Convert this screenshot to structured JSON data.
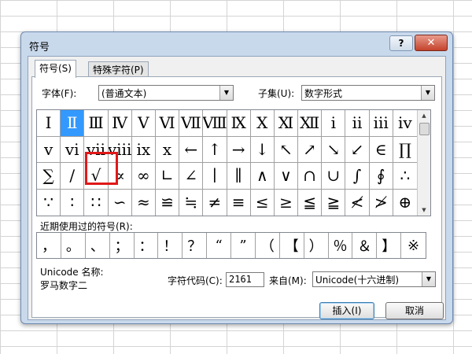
{
  "dialog": {
    "title": "符号",
    "help_label": "?",
    "close_label": "✕",
    "tabs": [
      {
        "label": "符号(S)"
      },
      {
        "label": "特殊字符(P)"
      }
    ],
    "font_label": "字体(F):",
    "font_value": "(普通文本)",
    "subset_label": "子集(U):",
    "subset_value": "数字形式",
    "symbol_rows": [
      [
        "Ⅰ",
        "Ⅱ",
        "Ⅲ",
        "Ⅳ",
        "Ⅴ",
        "Ⅵ",
        "Ⅶ",
        "Ⅷ",
        "Ⅸ",
        "Ⅹ",
        "Ⅺ",
        "Ⅻ",
        "ⅰ",
        "ⅱ",
        "ⅲ",
        "ⅳ"
      ],
      [
        "ⅴ",
        "ⅵ",
        "ⅶ",
        "ⅷ",
        "ⅸ",
        "ⅹ",
        "←",
        "↑",
        "→",
        "↓",
        "↖",
        "↗",
        "↘",
        "↙",
        "∈",
        "∏"
      ],
      [
        "∑",
        "∕",
        "√",
        "∝",
        "∞",
        "∟",
        "∠",
        "∣",
        "∥",
        "∧",
        "∨",
        "∩",
        "∪",
        "∫",
        "∮",
        "∴"
      ],
      [
        "∵",
        "∶",
        "∷",
        "∽",
        "≈",
        "≌",
        "≒",
        "≠",
        "≡",
        "≤",
        "≥",
        "≦",
        "≧",
        "≮",
        "≯",
        "⊕"
      ]
    ],
    "selected_symbol": "Ⅱ",
    "highlighted_symbol": "√",
    "recent_label": "近期使用过的符号(R):",
    "recent_symbols": [
      "，",
      "。",
      "、",
      "；",
      "：",
      "！",
      "？",
      "“",
      "”",
      "（",
      "【",
      "）",
      "％",
      "＆",
      "】",
      "※"
    ],
    "unicode_name_label": "Unicode 名称:",
    "unicode_name_value": "罗马数字二",
    "char_code_label": "字符代码(C):",
    "char_code_value": "2161",
    "from_label": "来自(M):",
    "from_value": "Unicode(十六进制)",
    "insert_label": "插入(I)",
    "cancel_label": "取消"
  },
  "colors": {
    "selection": "#3399ff",
    "highlight_box": "#e01818",
    "dialog_frame": "#c9d9ec"
  }
}
